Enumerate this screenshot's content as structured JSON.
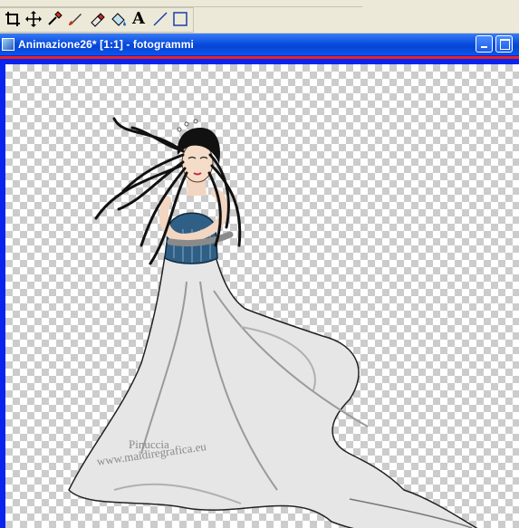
{
  "toolbar": {
    "tools": [
      {
        "name": "crop-icon"
      },
      {
        "name": "move-icon"
      },
      {
        "name": "dropper-icon"
      },
      {
        "name": "brush-icon"
      },
      {
        "name": "eraser-icon"
      },
      {
        "name": "fill-icon"
      },
      {
        "name": "text-icon",
        "glyph": "A"
      },
      {
        "name": "line-icon"
      },
      {
        "name": "rectangle-icon"
      }
    ]
  },
  "window": {
    "title": "Animazione26* [1:1] - fotogrammi",
    "title_bar_color": "#0a4fe0",
    "frame_color": "#0a24f0",
    "accent_line_color": "#e8231e"
  },
  "canvas": {
    "background": "transparency checkerboard",
    "watermark": {
      "name": "Pinuccia",
      "url": "www.maidiregrafica.eu"
    }
  }
}
